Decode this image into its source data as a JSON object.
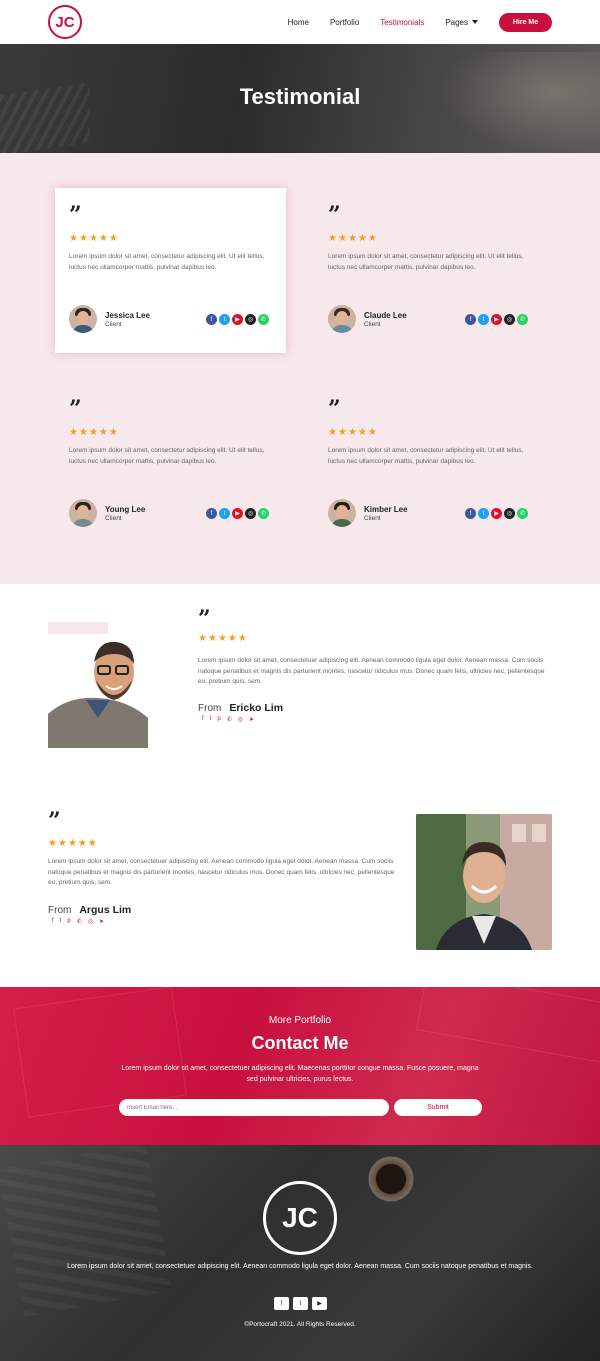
{
  "brand": {
    "logo": "JC",
    "accent": "#c8103e"
  },
  "nav": {
    "items": [
      {
        "label": "Home",
        "active": false
      },
      {
        "label": "Portfolio",
        "active": false
      },
      {
        "label": "Testimonials",
        "active": true
      },
      {
        "label": "Pages",
        "active": false,
        "dropdown": true
      }
    ],
    "cta": "Hire Me"
  },
  "hero": {
    "title": "Testimonial"
  },
  "testimonials": {
    "quote_glyph": "”",
    "rating_stars": 5,
    "items": [
      {
        "name": "Jessica Lee",
        "role": "Client",
        "text": "Lorem ipsum dolor sit amet, consectetur adipiscing elit. Ut elit tellus, luctus nec ullamcorper mattis, pulvinar dapibus leo.",
        "highlighted": true
      },
      {
        "name": "Claude Lee",
        "role": "Client",
        "text": "Lorem ipsum dolor sit amet, consectetur adipiscing elit. Ut elit tellus, luctus nec ullamcorper mattis, pulvinar dapibus leo.",
        "highlighted": false
      },
      {
        "name": "Young Lee",
        "role": "Client",
        "text": "Lorem ipsum dolor sit amet, consectetur adipiscing elit. Ut elit tellus, luctus nec ullamcorper mattis, pulvinar dapibus leo.",
        "highlighted": false
      },
      {
        "name": "Kimber Lee",
        "role": "Client",
        "text": "Lorem ipsum dolor sit amet, consectetur adipiscing elit. Ut elit tellus, luctus nec ullamcorper mattis, pulvinar dapibus leo.",
        "highlighted": false
      }
    ],
    "social_icons": [
      "facebook-icon",
      "twitter-icon",
      "youtube-icon",
      "instagram-icon",
      "whatsapp-icon"
    ],
    "social_colors": [
      "#3b5998",
      "#1da1f2",
      "#e0102c",
      "#222222",
      "#25d366"
    ]
  },
  "featured": [
    {
      "from_label": "From",
      "name": "Ericko Lim",
      "text": "Lorem ipsum dolor sit amet, consectetuer adipiscing elit. Aenean commodo ligula eget dolor. Aenean massa. Cum sociis natoque penatibus et magnis dis parturient montes, nascetur ridiculus mus. Donec quam felis, ultricies nec, pellentesque eu, pretium quis, sem."
    },
    {
      "from_label": "From",
      "name": "Argus Lim",
      "text": "Lorem ipsum dolor sit amet, consectetuer adipiscing elit. Aenean commodo ligula eget dolor. Aenean massa. Cum sociis natoque penatibus et magnis dis parturient montes, nascetur ridiculus mus. Donec quam felis, ultricies nec, pellentesque eu, pretium quis, sem."
    }
  ],
  "featured_social_icons": [
    "facebook-icon",
    "twitter-icon",
    "pinterest-icon",
    "whatsapp-icon",
    "instagram-icon",
    "telegram-icon"
  ],
  "contact": {
    "subtitle": "More Portfolio",
    "title": "Contact Me",
    "text": "Lorem ipsum dolor sit amet, consectetuer adipiscing elit. Maecenas porttitor congue massa. Fusce posuere, magna sed pulvinar ultricies, purus lectus.",
    "input_placeholder": "Insert Email here...",
    "submit": "Submit"
  },
  "footer": {
    "logo": "JC",
    "text": "Lorem ipsum dolor sit amet, consectetuer adipiscing elit. Aenean commodo ligula eget dolor. Aenean massa. Cum sociis natoque penatibus et magnis.",
    "social_icons": [
      "facebook-icon",
      "twitter-icon",
      "youtube-icon"
    ],
    "copyright": "©Portocraft 2021. All Rights Reserved."
  }
}
